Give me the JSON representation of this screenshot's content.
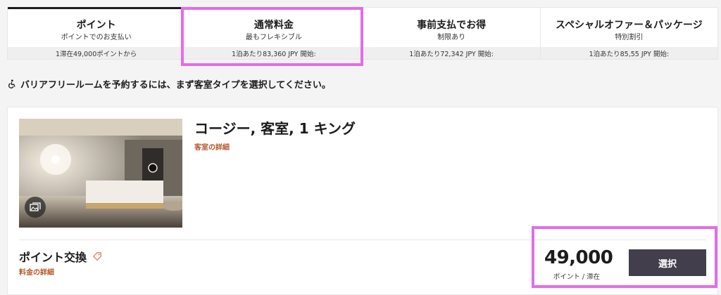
{
  "tabs": [
    {
      "title": "ポイント",
      "subtitle": "ポイントでのお支払い",
      "price": "1滞在49,000ポイントから"
    },
    {
      "title": "通常料金",
      "subtitle": "最もフレキシブル",
      "price": "1泊あたり83,360 JPY 開始:"
    },
    {
      "title": "事前支払でお得",
      "subtitle": "制限あり",
      "price": "1泊あたり72,342 JPY 開始:"
    },
    {
      "title": "スペシャルオファー＆パッケージ",
      "subtitle": "特別割引",
      "price": "1泊あたり85,55 JPY 開始:"
    }
  ],
  "notice": "バリアフリールームを予約するには、まず客室タイプを選択してください。",
  "room": {
    "title": "コージー, 客室, 1 キング",
    "details_link": "客室の詳細"
  },
  "rate": {
    "title": "ポイント交換",
    "details_link": "料金の詳細",
    "points": "49,000",
    "unit": "ポイント / 滞在",
    "select_label": "選択"
  },
  "colors": {
    "accent_link": "#b8582b",
    "select_button": "#423e4b",
    "highlight": "#e26de8"
  }
}
